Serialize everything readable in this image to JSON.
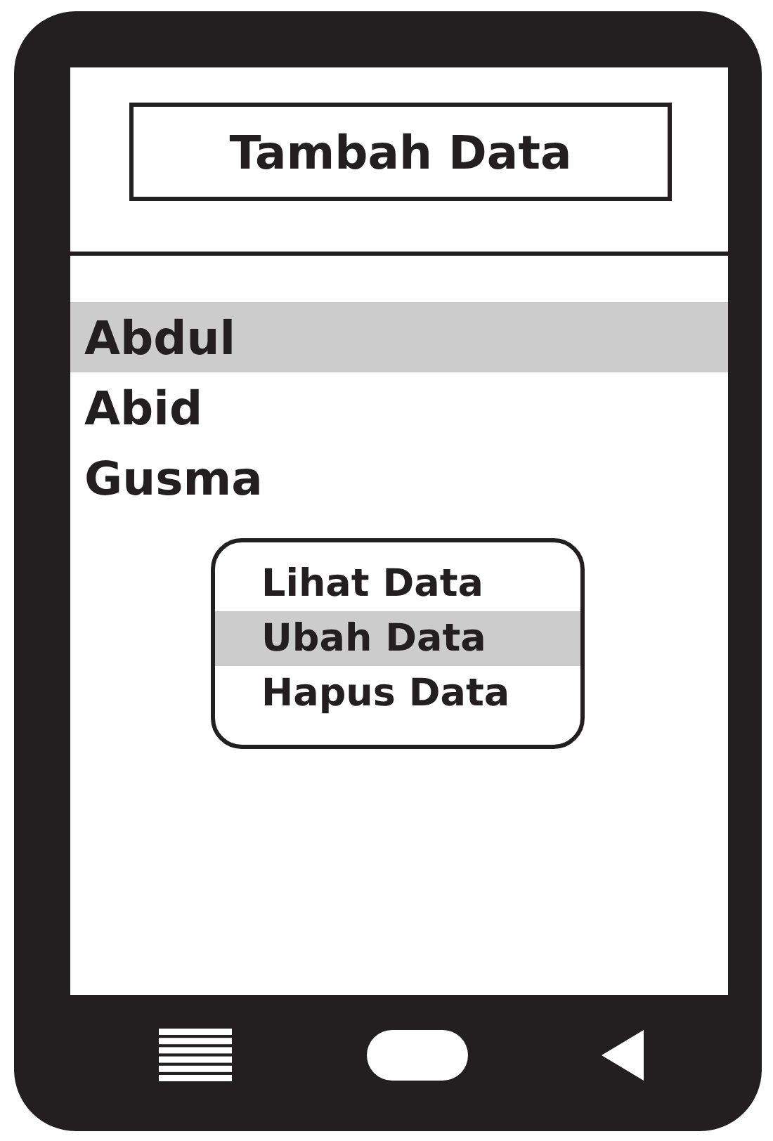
{
  "header": {
    "button": "Tambah Data"
  },
  "list": [
    {
      "label": "Abdul",
      "selected": true
    },
    {
      "label": "Abid",
      "selected": false
    },
    {
      "label": "Gusma",
      "selected": false
    }
  ],
  "context_menu": [
    {
      "label": "Lihat Data",
      "selected": false
    },
    {
      "label": "Ubah Data",
      "selected": true
    },
    {
      "label": "Hapus Data",
      "selected": false
    }
  ]
}
